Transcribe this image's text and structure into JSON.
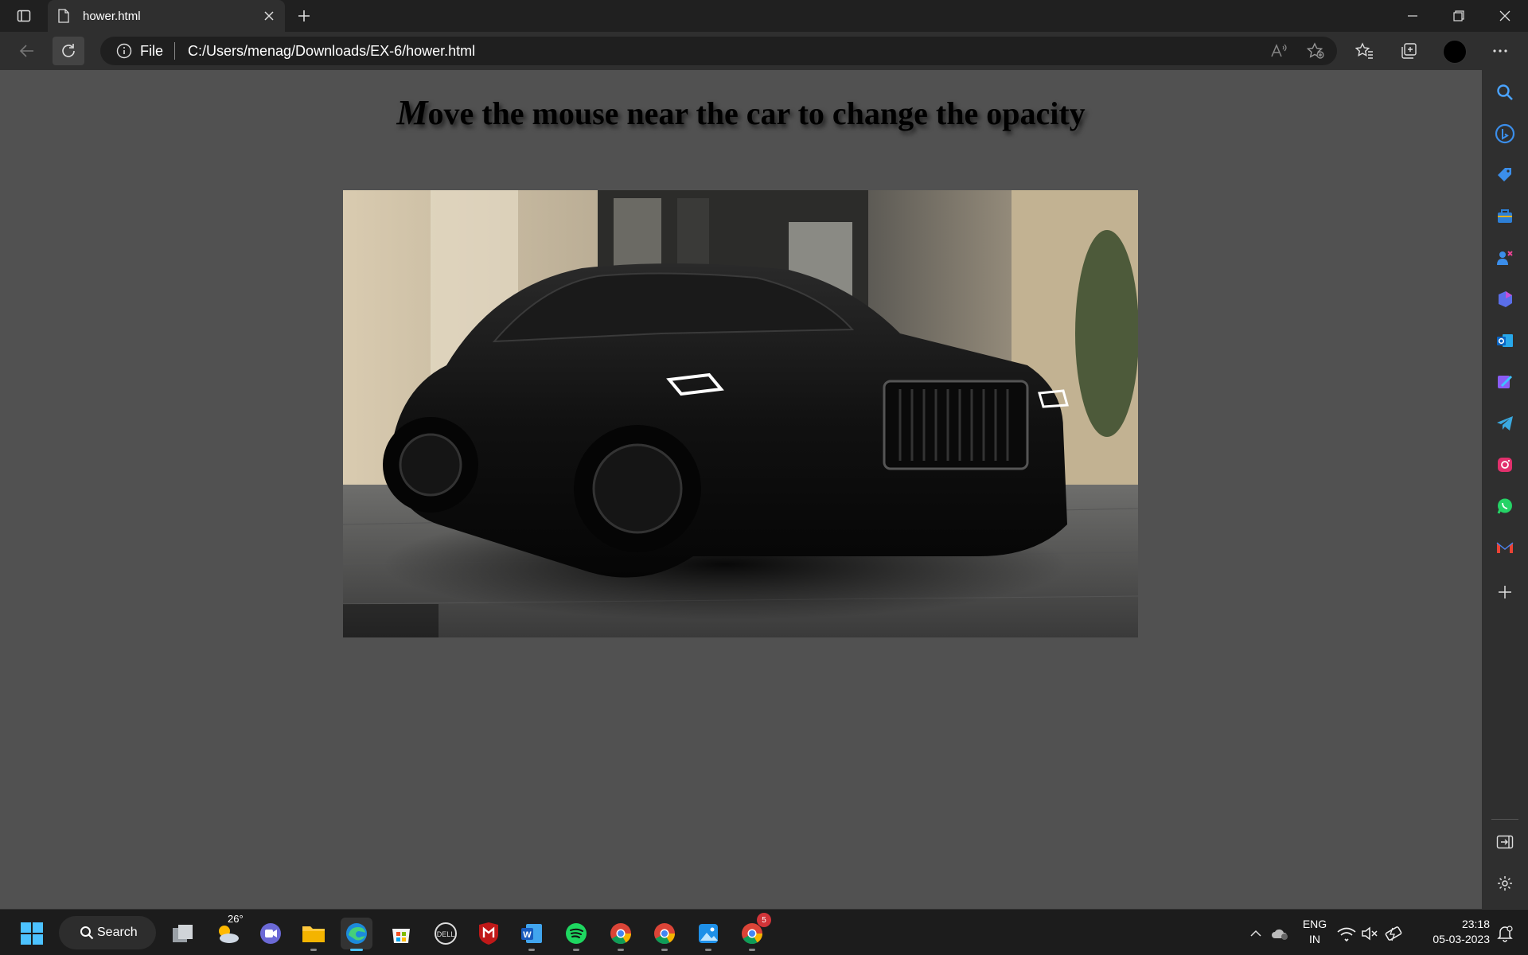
{
  "browser": {
    "tab_title": "hower.html",
    "address_scheme": "File",
    "address_url": "C:/Users/menag/Downloads/EX-6/hower.html"
  },
  "page": {
    "heading_first": "M",
    "heading_rest": "ove the mouse near the car to change the opacity"
  },
  "sidebar": {
    "icons": [
      "search-icon",
      "bing-chat-icon",
      "shopping-tag-icon",
      "tools-briefcase-icon",
      "games-icon",
      "office-icon",
      "outlook-icon",
      "designer-icon",
      "telegram-icon",
      "instagram-icon",
      "whatsapp-icon",
      "gmail-icon",
      "add-icon",
      "hide-sidebar-icon",
      "settings-icon"
    ]
  },
  "taskbar": {
    "search_label": "Search",
    "weather_temp": "26°",
    "lang_line1": "ENG",
    "lang_line2": "IN",
    "time": "23:18",
    "date": "05-03-2023",
    "chrome_badge": "5"
  },
  "colors": {
    "page_background": "#515151",
    "browser_chrome": "#2f2f2f",
    "titlebar": "#202020"
  }
}
